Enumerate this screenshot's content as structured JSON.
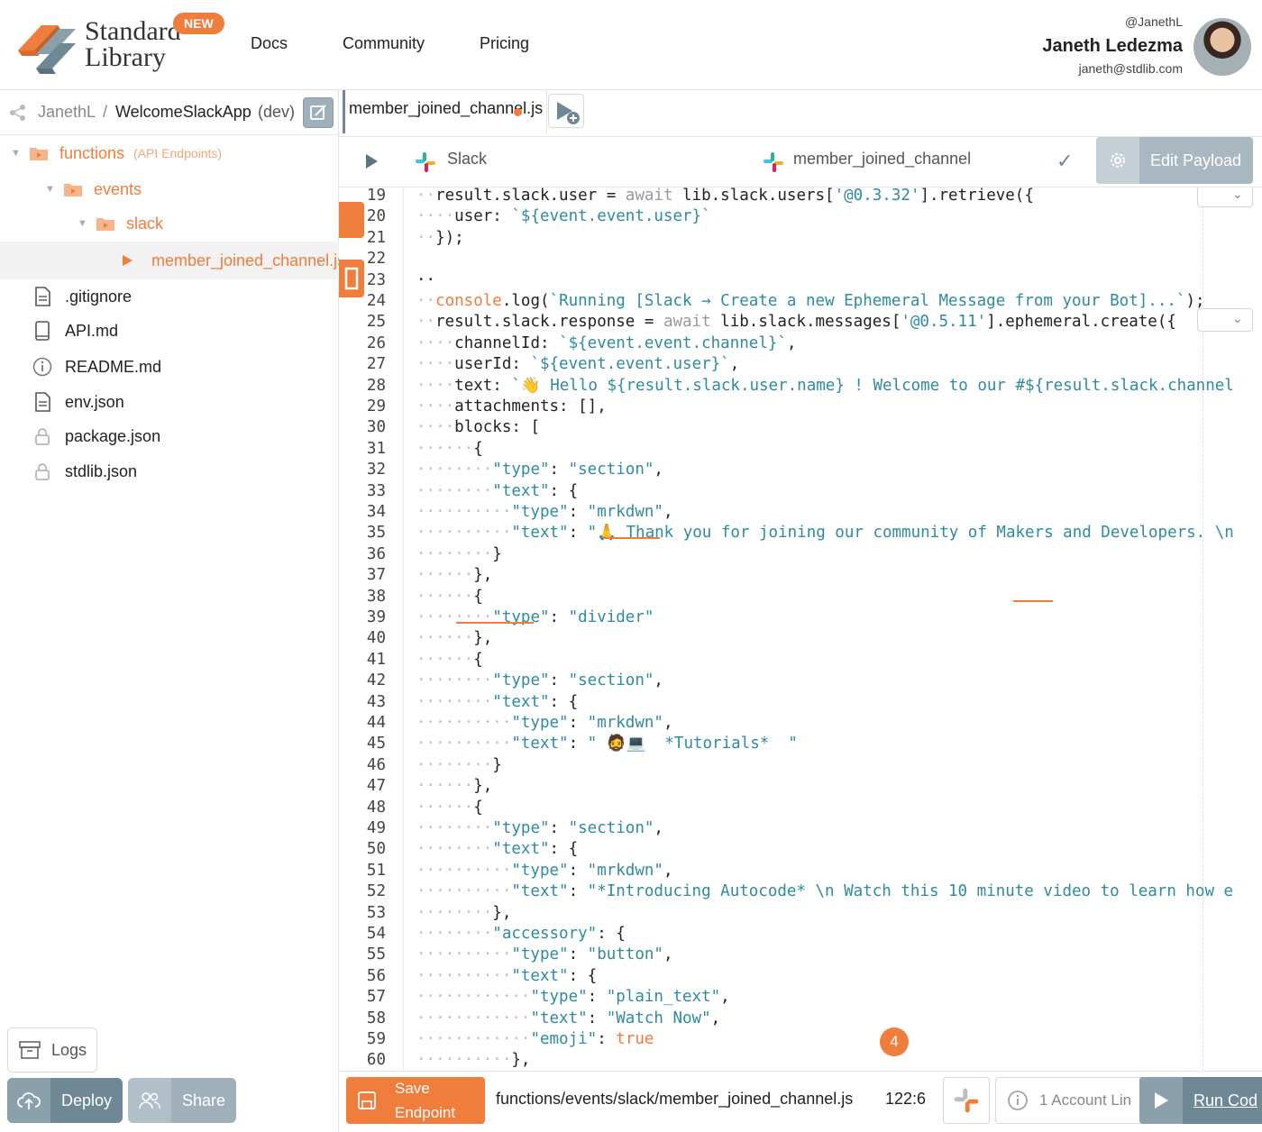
{
  "brand": {
    "logo_line1": "Standard",
    "logo_line2": "Library",
    "new_badge": "NEW",
    "accent": "#ef7d3b",
    "slate": "#6f8895"
  },
  "nav": {
    "links": [
      "Docs",
      "Community",
      "Pricing"
    ]
  },
  "user": {
    "handle": "@JanethL",
    "name": "Janeth Ledezma",
    "email": "janeth@stdlib.com"
  },
  "project": {
    "owner": "JanethL",
    "separator": "/",
    "name": "WelcomeSlackApp",
    "env": "(dev)"
  },
  "tree": {
    "functions": "functions",
    "functions_note": "(API Endpoints)",
    "events": "events",
    "slack": "slack",
    "selected_file": "member_joined_channel.js",
    "files": [
      {
        "name": ".gitignore",
        "icon": "doc-icon"
      },
      {
        "name": "API.md",
        "icon": "book-icon"
      },
      {
        "name": "README.md",
        "icon": "info-icon"
      },
      {
        "name": "env.json",
        "icon": "doc-icon"
      },
      {
        "name": "package.json",
        "icon": "lock-icon"
      },
      {
        "name": "stdlib.json",
        "icon": "lock-icon"
      }
    ]
  },
  "sidebar_buttons": {
    "logs": "Logs",
    "deploy": "Deploy",
    "share": "Share"
  },
  "tab": {
    "filename": "member_joined_channel.js"
  },
  "toolbar": {
    "service": "Slack",
    "event": "member_joined_channel",
    "edit_payload": "Edit Payload"
  },
  "code": {
    "lines": [
      {
        "n": "19",
        "t": "  result.slack.user = await lib.slack.users['@0.3.32'].retrieve({"
      },
      {
        "n": "20",
        "t": "    user: `${event.event.user}`"
      },
      {
        "n": "21",
        "t": "  });"
      },
      {
        "n": "22",
        "t": ""
      },
      {
        "n": "23",
        "t": "··"
      },
      {
        "n": "24",
        "t": "  console.log(`Running [Slack → Create a new Ephemeral Message from your Bot]...`);"
      },
      {
        "n": "25",
        "t": "  result.slack.response = await lib.slack.messages['@0.5.11'].ephemeral.create({"
      },
      {
        "n": "26",
        "t": "    channelId: `${event.event.channel}`,"
      },
      {
        "n": "27",
        "t": "    userId: `${event.event.user}`,"
      },
      {
        "n": "28",
        "t": "    text: `👋 Hello ${result.slack.user.name} ! Welcome to our #${result.slack.channel"
      },
      {
        "n": "29",
        "t": "    attachments: [],"
      },
      {
        "n": "30",
        "t": "    blocks: ["
      },
      {
        "n": "31",
        "t": "      {"
      },
      {
        "n": "32",
        "t": "        \"type\": \"section\","
      },
      {
        "n": "33",
        "t": "        \"text\": {"
      },
      {
        "n": "34",
        "t": "          \"type\": \"mrkdwn\","
      },
      {
        "n": "35",
        "t": "          \"text\": \"🙏 Thank you for joining our community of Makers and Developers. \\n"
      },
      {
        "n": "36",
        "t": "        }"
      },
      {
        "n": "37",
        "t": "      },"
      },
      {
        "n": "38",
        "t": "      {"
      },
      {
        "n": "39",
        "t": "        \"type\": \"divider\""
      },
      {
        "n": "40",
        "t": "      },"
      },
      {
        "n": "41",
        "t": "      {"
      },
      {
        "n": "42",
        "t": "        \"type\": \"section\","
      },
      {
        "n": "43",
        "t": "        \"text\": {"
      },
      {
        "n": "44",
        "t": "          \"type\": \"mrkdwn\","
      },
      {
        "n": "45",
        "t": "          \"text\": \" 🧔💻  *Tutorials*  \""
      },
      {
        "n": "46",
        "t": "        }"
      },
      {
        "n": "47",
        "t": "      },"
      },
      {
        "n": "48",
        "t": "      {"
      },
      {
        "n": "49",
        "t": "        \"type\": \"section\","
      },
      {
        "n": "50",
        "t": "        \"text\": {"
      },
      {
        "n": "51",
        "t": "          \"type\": \"mrkdwn\","
      },
      {
        "n": "52",
        "t": "          \"text\": \"*Introducing Autocode* \\n Watch this 10 minute video to learn how e"
      },
      {
        "n": "53",
        "t": "        },"
      },
      {
        "n": "54",
        "t": "        \"accessory\": {"
      },
      {
        "n": "55",
        "t": "          \"type\": \"button\","
      },
      {
        "n": "56",
        "t": "          \"text\": {"
      },
      {
        "n": "57",
        "t": "            \"type\": \"plain_text\","
      },
      {
        "n": "58",
        "t": "            \"text\": \"Watch Now\","
      },
      {
        "n": "59",
        "t": "            \"emoji\": true"
      },
      {
        "n": "60",
        "t": "          },"
      }
    ]
  },
  "status": {
    "save_line1": "Save",
    "save_line2": "Endpoint",
    "path": "functions/events/slack/member_joined_channel.js",
    "position": "122:6",
    "account_links": "1 Account Lin",
    "run": "Run Cod",
    "notifications": "4"
  }
}
